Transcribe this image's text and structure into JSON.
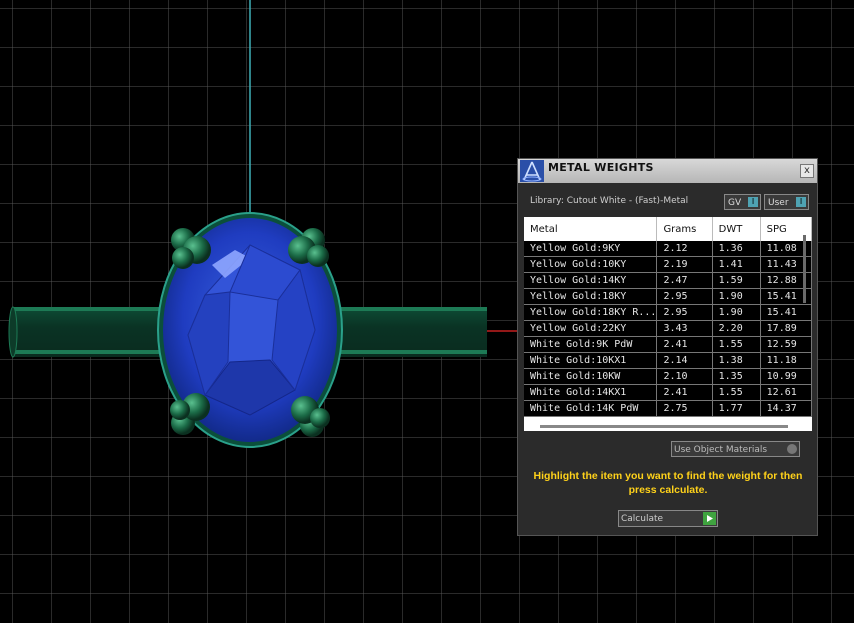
{
  "panel": {
    "title": "METAL WEIGHTS",
    "close_label": "x",
    "library_text": "Library: Cutout White - (Fast)-Metal",
    "toggles": [
      {
        "label": "GV",
        "indicator": "I"
      },
      {
        "label": "User",
        "indicator": "I"
      }
    ],
    "table": {
      "columns": [
        "Metal",
        "Grams",
        "DWT",
        "SPG"
      ],
      "rows": [
        [
          "Yellow Gold:9KY",
          "2.12",
          "1.36",
          "11.08"
        ],
        [
          "Yellow Gold:10KY",
          "2.19",
          "1.41",
          "11.43"
        ],
        [
          "Yellow Gold:14KY",
          "2.47",
          "1.59",
          "12.88"
        ],
        [
          "Yellow Gold:18KY",
          "2.95",
          "1.90",
          "15.41"
        ],
        [
          "Yellow Gold:18KY R...",
          "2.95",
          "1.90",
          "15.41"
        ],
        [
          "Yellow Gold:22KY",
          "3.43",
          "2.20",
          "17.89"
        ],
        [
          "White Gold:9K PdW",
          "2.41",
          "1.55",
          "12.59"
        ],
        [
          "White Gold:10KX1",
          "2.14",
          "1.38",
          "11.18"
        ],
        [
          "White Gold:10KW",
          "2.10",
          "1.35",
          "10.99"
        ],
        [
          "White Gold:14KX1",
          "2.41",
          "1.55",
          "12.61"
        ],
        [
          "White Gold:14K PdW",
          "2.75",
          "1.77",
          "14.37"
        ]
      ]
    },
    "use_object_materials": "Use Object Materials",
    "instructions": "Highlight the item you want to find the weight for then press calculate.",
    "calculate_label": "Calculate"
  },
  "icons": [
    "logo-icon",
    "close-icon",
    "play-icon"
  ],
  "colors": {
    "viewport_bg": "#000000",
    "grid": "#5a5a5a",
    "gem_blue": "#2040c8",
    "prong_green": "#1f7a55",
    "instruction_text": "#ffd21a",
    "axis_cyan": "#3fb0b8",
    "axis_red": "#c42020"
  }
}
